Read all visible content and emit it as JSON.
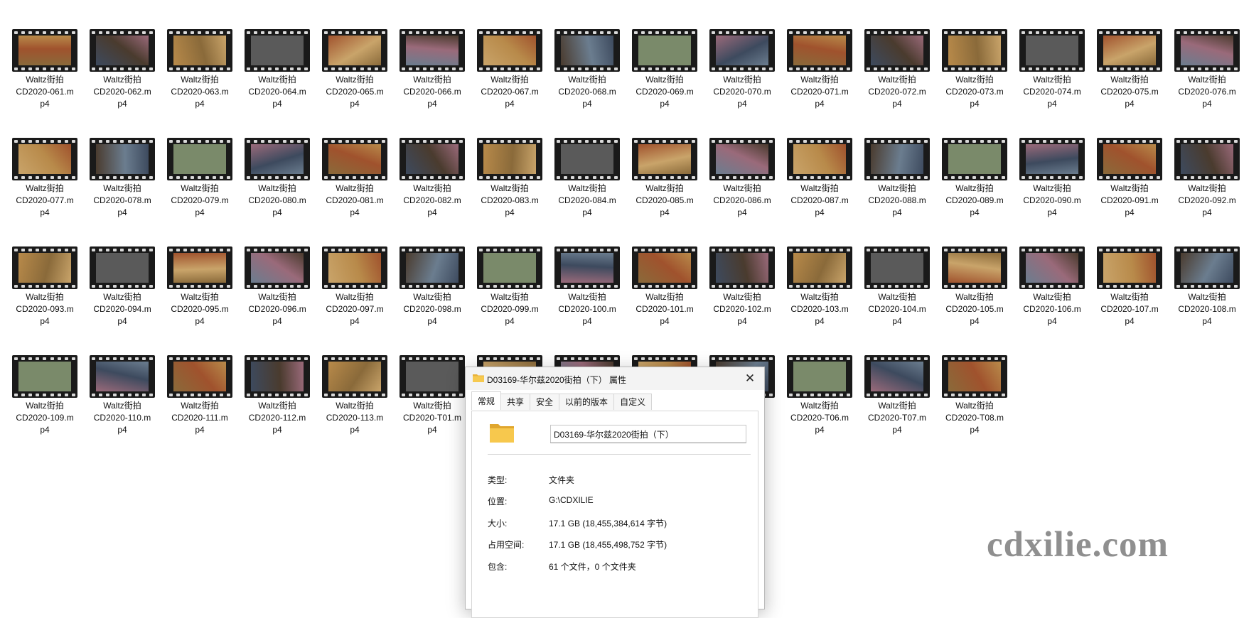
{
  "files": [
    "Waltz街拍\nCD2020-061.m\np4",
    "Waltz街拍\nCD2020-062.m\np4",
    "Waltz街拍\nCD2020-063.m\np4",
    "Waltz街拍\nCD2020-064.m\np4",
    "Waltz街拍\nCD2020-065.m\np4",
    "Waltz街拍\nCD2020-066.m\np4",
    "Waltz街拍\nCD2020-067.m\np4",
    "Waltz街拍\nCD2020-068.m\np4",
    "Waltz街拍\nCD2020-069.m\np4",
    "Waltz街拍\nCD2020-070.m\np4",
    "Waltz街拍\nCD2020-071.m\np4",
    "Waltz街拍\nCD2020-072.m\np4",
    "Waltz街拍\nCD2020-073.m\np4",
    "Waltz街拍\nCD2020-074.m\np4",
    "Waltz街拍\nCD2020-075.m\np4",
    "Waltz街拍\nCD2020-076.m\np4",
    "Waltz街拍\nCD2020-077.m\np4",
    "Waltz街拍\nCD2020-078.m\np4",
    "Waltz街拍\nCD2020-079.m\np4",
    "Waltz街拍\nCD2020-080.m\np4",
    "Waltz街拍\nCD2020-081.m\np4",
    "Waltz街拍\nCD2020-082.m\np4",
    "Waltz街拍\nCD2020-083.m\np4",
    "Waltz街拍\nCD2020-084.m\np4",
    "Waltz街拍\nCD2020-085.m\np4",
    "Waltz街拍\nCD2020-086.m\np4",
    "Waltz街拍\nCD2020-087.m\np4",
    "Waltz街拍\nCD2020-088.m\np4",
    "Waltz街拍\nCD2020-089.m\np4",
    "Waltz街拍\nCD2020-090.m\np4",
    "Waltz街拍\nCD2020-091.m\np4",
    "Waltz街拍\nCD2020-092.m\np4",
    "Waltz街拍\nCD2020-093.m\np4",
    "Waltz街拍\nCD2020-094.m\np4",
    "Waltz街拍\nCD2020-095.m\np4",
    "Waltz街拍\nCD2020-096.m\np4",
    "Waltz街拍\nCD2020-097.m\np4",
    "Waltz街拍\nCD2020-098.m\np4",
    "Waltz街拍\nCD2020-099.m\np4",
    "Waltz街拍\nCD2020-100.m\np4",
    "Waltz街拍\nCD2020-101.m\np4",
    "Waltz街拍\nCD2020-102.m\np4",
    "Waltz街拍\nCD2020-103.m\np4",
    "Waltz街拍\nCD2020-104.m\np4",
    "Waltz街拍\nCD2020-105.m\np4",
    "Waltz街拍\nCD2020-106.m\np4",
    "Waltz街拍\nCD2020-107.m\np4",
    "Waltz街拍\nCD2020-108.m\np4",
    "Waltz街拍\nCD2020-109.m\np4",
    "Waltz街拍\nCD2020-110.m\np4",
    "Waltz街拍\nCD2020-111.m\np4",
    "Waltz街拍\nCD2020-112.m\np4",
    "Waltz街拍\nCD2020-113.m\np4",
    "Waltz街拍\nCD2020-T01.m\np4",
    "",
    "",
    "",
    "",
    "Waltz街拍\nCD2020-T06.m\np4",
    "Waltz街拍\nCD2020-T07.m\np4",
    "Waltz街拍\nCD2020-T08.m\np4"
  ],
  "dialog": {
    "title": "D03169-华尔兹2020街拍（下） 属性",
    "close_glyph": "✕",
    "tabs": [
      "常规",
      "共享",
      "安全",
      "以前的版本",
      "自定义"
    ],
    "active_tab": "常规",
    "folder_name": "D03169-华尔兹2020街拍（下）",
    "properties": [
      {
        "label": "类型:",
        "value": "文件夹"
      },
      {
        "label": "位置:",
        "value": "G:\\CDXILIE"
      },
      {
        "label": "大小:",
        "value": "17.1 GB (18,455,384,614 字节)"
      },
      {
        "label": "占用空间:",
        "value": "17.1 GB (18,455,498,752 字节)"
      },
      {
        "label": "包含:",
        "value": "61 个文件，0 个文件夹"
      }
    ]
  },
  "watermark": "cdxilie.com",
  "colors": {
    "film_strip": "#1a1a1a",
    "sprocket_hole": "#d9d9d9",
    "folder_yellow": "#f0c04a",
    "watermark_gray": "#8f8f8f",
    "frame_palette": [
      "#8a6a3a",
      "#3d4a5e",
      "#b88a4a",
      "#5a5a5a",
      "#a0522d",
      "#6b7d8f",
      "#c9a46a",
      "#4a3b2e",
      "#7a8a6a",
      "#9a6a7a"
    ]
  }
}
